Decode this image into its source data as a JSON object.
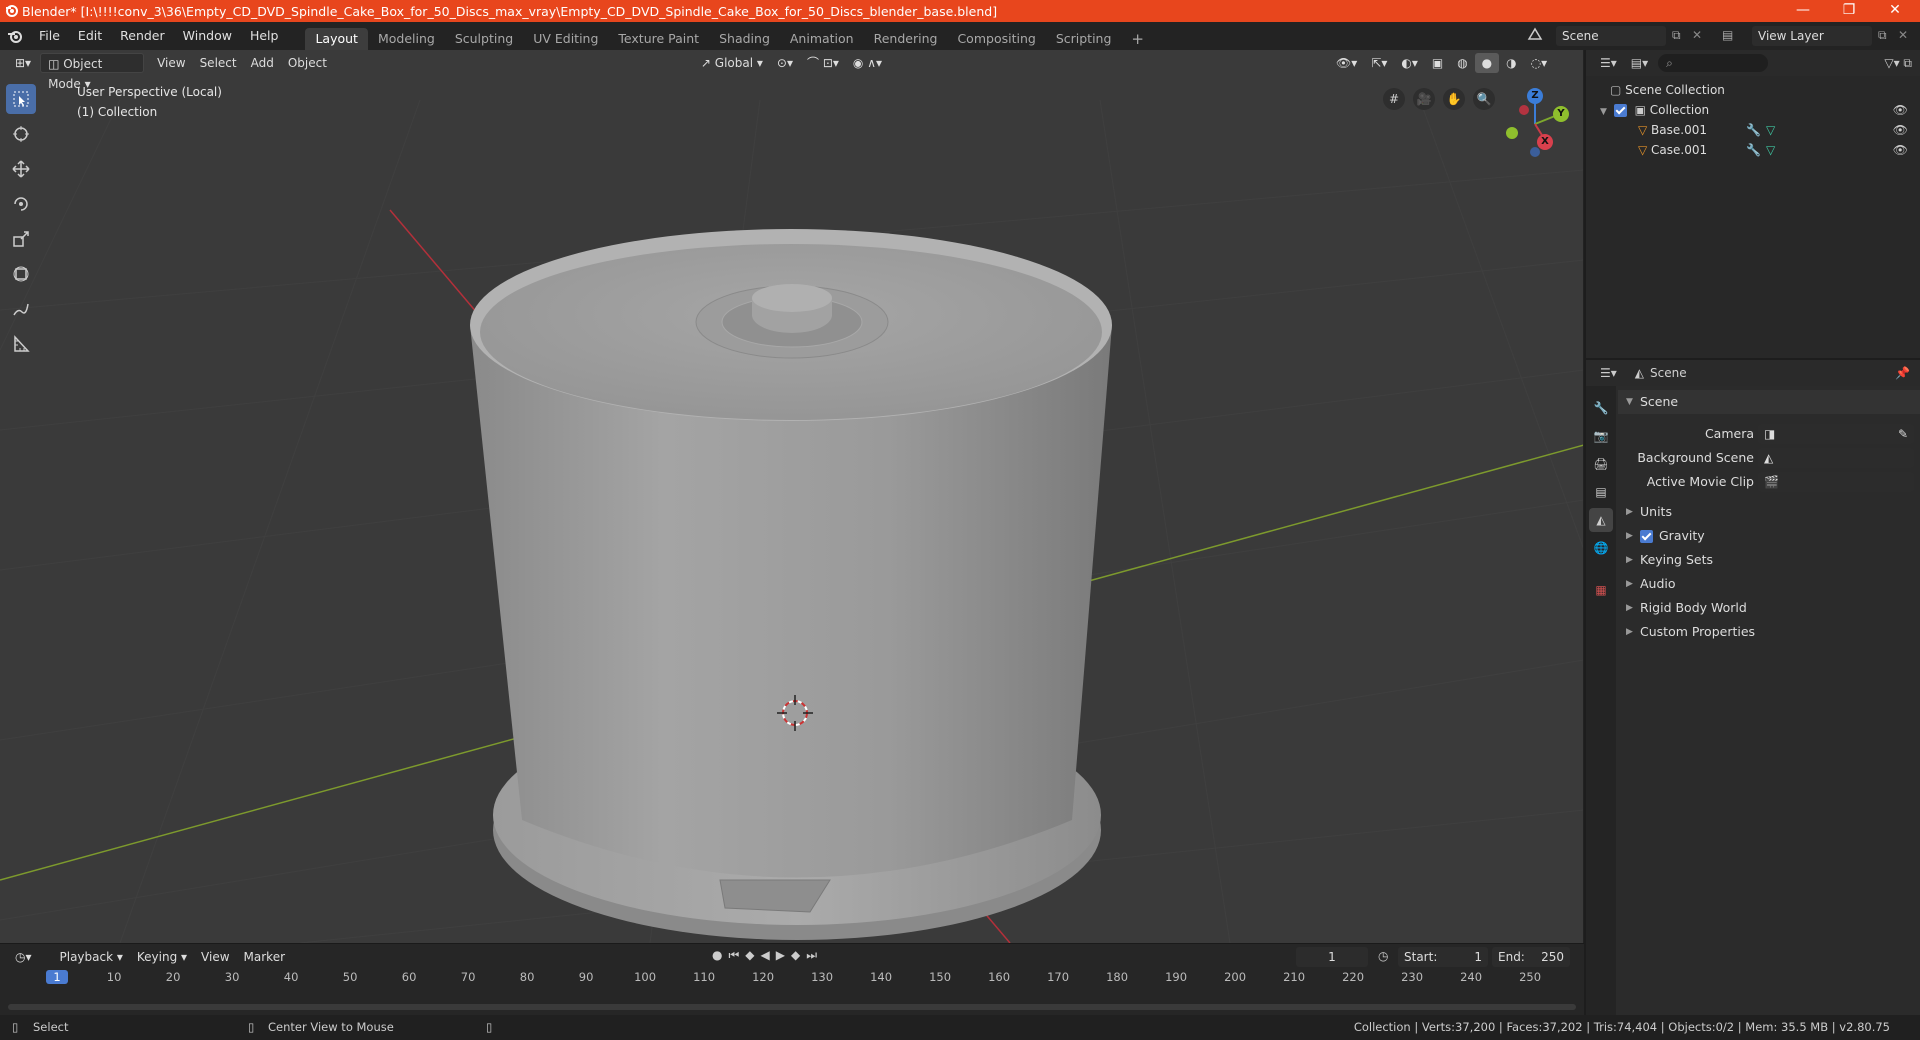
{
  "window": {
    "title": "Blender* [I:\\!!!!conv_3\\36\\Empty_CD_DVD_Spindle_Cake_Box_for_50_Discs_max_vray\\Empty_CD_DVD_Spindle_Cake_Box_for_50_Discs_blender_base.blend]",
    "minimize": "—",
    "restore": "❐",
    "close": "✕"
  },
  "menus": [
    "File",
    "Edit",
    "Render",
    "Window",
    "Help"
  ],
  "workspaces": [
    "Layout",
    "Modeling",
    "Sculpting",
    "UV Editing",
    "Texture Paint",
    "Shading",
    "Animation",
    "Rendering",
    "Compositing",
    "Scripting"
  ],
  "workspace_add": "+",
  "scene_selector": {
    "value": "Scene"
  },
  "view_layer_selector": {
    "value": "View Layer"
  },
  "viewport": {
    "mode": "Object Mode",
    "menus": [
      "View",
      "Select",
      "Add",
      "Object"
    ],
    "transform_orientation": "Global",
    "overlay_line1": "User Perspective (Local)",
    "overlay_line2": "(1) Collection",
    "gizmo": {
      "z": "Z",
      "y": "Y",
      "x": "X"
    }
  },
  "outliner": {
    "root": "Scene Collection",
    "collection": "Collection",
    "objects": [
      "Base.001",
      "Case.001"
    ]
  },
  "properties": {
    "header": "Scene",
    "panel_title": "Scene",
    "fields": [
      {
        "label": "Camera",
        "value": ""
      },
      {
        "label": "Background Scene",
        "value": ""
      },
      {
        "label": "Active Movie Clip",
        "value": ""
      }
    ],
    "subpanels": [
      "Units",
      "Gravity",
      "Keying Sets",
      "Audio",
      "Rigid Body World",
      "Custom Properties"
    ],
    "gravity_checked": true
  },
  "timeline": {
    "menus": [
      "Playback",
      "Keying",
      "View",
      "Marker"
    ],
    "current_frame": "1",
    "start_label": "Start:",
    "start": "1",
    "end_label": "End:",
    "end": "250",
    "ticks": [
      "1",
      "10",
      "20",
      "30",
      "40",
      "50",
      "60",
      "70",
      "80",
      "90",
      "100",
      "110",
      "120",
      "130",
      "140",
      "150",
      "160",
      "170",
      "180",
      "190",
      "200",
      "210",
      "220",
      "230",
      "240",
      "250"
    ]
  },
  "statusbar": {
    "left": "Select",
    "middle": "Center View to Mouse",
    "right": "Collection | Verts:37,200 | Faces:37,202 | Tris:74,404 | Objects:0/2 | Mem: 35.5 MB | v2.80.75"
  },
  "colors": {
    "titlebar": "#e8461d",
    "viewport_bg": "#3a3a3a",
    "x_axis": "#b3303a",
    "y_axis": "#7d9a2d",
    "accent": "#4a7bd1"
  }
}
